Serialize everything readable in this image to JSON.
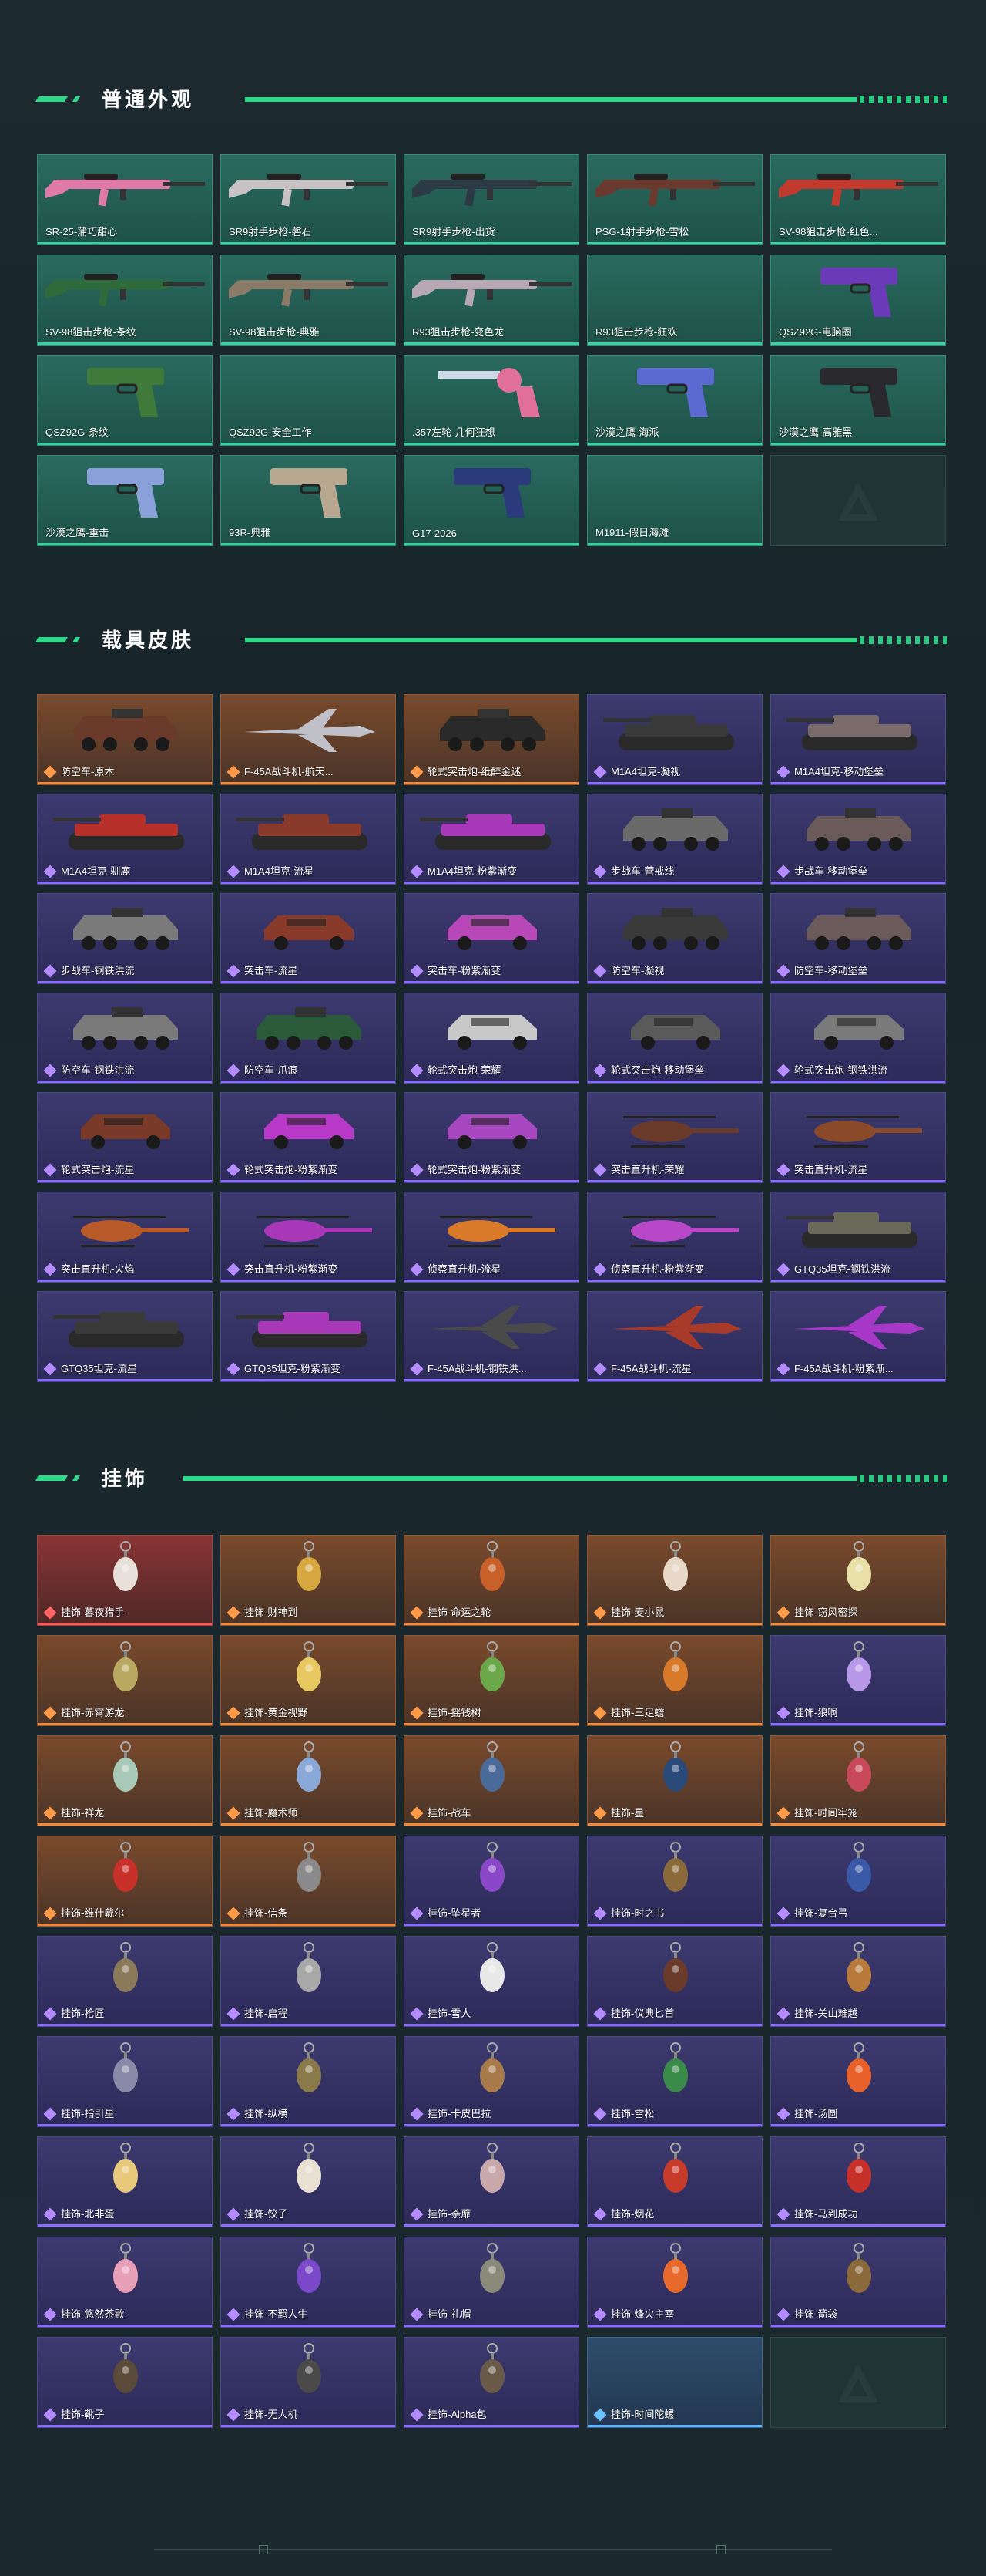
{
  "colors": {
    "accent": "#2fd98a",
    "teal": "#2a6a5f",
    "purple": "#3d3a70",
    "orange": "#7a4a2c",
    "red": "#8a3434",
    "blue": "#2e4c6c"
  },
  "sections": [
    {
      "title": "普通外观",
      "items": [
        {
          "label": "SR-25-蒲巧甜心",
          "rarity": "teal",
          "art": "rifle",
          "color": "#e07aa8"
        },
        {
          "label": "SR9射手步枪-磐石",
          "rarity": "teal",
          "art": "rifle",
          "color": "#c9c2c4"
        },
        {
          "label": "SR9射手步枪-出货",
          "rarity": "teal",
          "art": "rifle",
          "color": "#2b3a44"
        },
        {
          "label": "PSG-1射手步枪-雪松",
          "rarity": "teal",
          "art": "rifle",
          "color": "#6a3a2e"
        },
        {
          "label": "SV-98狙击步枪-红色...",
          "rarity": "teal",
          "art": "rifle",
          "color": "#c23a2e"
        },
        {
          "label": "SV-98狙击步枪-条纹",
          "rarity": "teal",
          "art": "rifle",
          "color": "#2f6a3a"
        },
        {
          "label": "SV-98狙击步枪-典雅",
          "rarity": "teal",
          "art": "rifle",
          "color": "#8a7a68"
        },
        {
          "label": "R93狙击步枪-变色龙",
          "rarity": "teal",
          "art": "rifle",
          "color": "#b8a8b4"
        },
        {
          "label": "R93狙击步枪-狂欢",
          "rarity": "teal",
          "art": "none",
          "color": "#000000"
        },
        {
          "label": "QSZ92G-电脑圈",
          "rarity": "teal",
          "art": "pistol",
          "color": "#6a3ab8"
        },
        {
          "label": "QSZ92G-条纹",
          "rarity": "teal",
          "art": "pistol",
          "color": "#3f7a3a"
        },
        {
          "label": "QSZ92G-安全工作",
          "rarity": "teal",
          "art": "none",
          "color": "#000000"
        },
        {
          "label": ".357左轮-几何狂想",
          "rarity": "teal",
          "art": "revolver",
          "color": "#e0709a"
        },
        {
          "label": "沙漠之鹰-海派",
          "rarity": "teal",
          "art": "pistol",
          "color": "#5a6ad0"
        },
        {
          "label": "沙漠之鹰-高雅黑",
          "rarity": "teal",
          "art": "pistol",
          "color": "#2a2a2e"
        },
        {
          "label": "沙漠之鹰-重击",
          "rarity": "teal",
          "art": "pistol",
          "color": "#8aa0d8"
        },
        {
          "label": "93R-典雅",
          "rarity": "teal",
          "art": "pistol",
          "color": "#b8a890"
        },
        {
          "label": "G17-2026",
          "rarity": "teal",
          "art": "pistol",
          "color": "#2a3a7a"
        },
        {
          "label": "M1911-假日海滩",
          "rarity": "teal",
          "art": "none",
          "color": "#000000"
        },
        {
          "label": "",
          "rarity": "empty",
          "art": "logo",
          "color": "#3a5856"
        }
      ]
    },
    {
      "title": "载具皮肤",
      "items": [
        {
          "label": "防空车-原木",
          "rarity": "orange",
          "art": "apc",
          "color": "#6a3a2a"
        },
        {
          "label": "F-45A战斗机-航天...",
          "rarity": "orange",
          "art": "jet",
          "color": "#c0c0c8"
        },
        {
          "label": "轮式突击炮-纸醉金迷",
          "rarity": "orange",
          "art": "apc",
          "color": "#2a2a2a"
        },
        {
          "label": "M1A4坦克-凝视",
          "rarity": "purple",
          "art": "tank",
          "color": "#3a3a3a"
        },
        {
          "label": "M1A4坦克-移动堡垒",
          "rarity": "purple",
          "art": "tank",
          "color": "#7a6a6a"
        },
        {
          "label": "M1A4坦克-驯鹿",
          "rarity": "purple",
          "art": "tank",
          "color": "#b8302a"
        },
        {
          "label": "M1A4坦克-流星",
          "rarity": "purple",
          "art": "tank",
          "color": "#8a3a2a"
        },
        {
          "label": "M1A4坦克-粉紫渐变",
          "rarity": "purple",
          "art": "tank",
          "color": "#a838b8"
        },
        {
          "label": "步战车-营戒线",
          "rarity": "purple",
          "art": "apc",
          "color": "#6a6a6a"
        },
        {
          "label": "步战车-移动堡垒",
          "rarity": "purple",
          "art": "apc",
          "color": "#6a5a5a"
        },
        {
          "label": "步战车-钢铁洪流",
          "rarity": "purple",
          "art": "apc",
          "color": "#7a7a7a"
        },
        {
          "label": "突击车-流星",
          "rarity": "purple",
          "art": "truck",
          "color": "#8a3a2a"
        },
        {
          "label": "突击车-粉紫渐变",
          "rarity": "purple",
          "art": "truck",
          "color": "#b848b8"
        },
        {
          "label": "防空车-凝视",
          "rarity": "purple",
          "art": "apc",
          "color": "#3a3a3a"
        },
        {
          "label": "防空车-移动堡垒",
          "rarity": "purple",
          "art": "apc",
          "color": "#6a5a5a"
        },
        {
          "label": "防空车-钢铁洪流",
          "rarity": "purple",
          "art": "apc",
          "color": "#7a7a7a"
        },
        {
          "label": "防空车-爪痕",
          "rarity": "purple",
          "art": "apc",
          "color": "#2a5a3a"
        },
        {
          "label": "轮式突击炮-荣耀",
          "rarity": "purple",
          "art": "truck",
          "color": "#c8c8c8"
        },
        {
          "label": "轮式突击炮-移动堡垒",
          "rarity": "purple",
          "art": "truck",
          "color": "#5a5a5a"
        },
        {
          "label": "轮式突击炮-钢铁洪流",
          "rarity": "purple",
          "art": "truck",
          "color": "#7a7a7a"
        },
        {
          "label": "轮式突击炮-流星",
          "rarity": "purple",
          "art": "truck",
          "color": "#7a3a2a"
        },
        {
          "label": "轮式突击炮-粉紫渐变",
          "rarity": "purple",
          "art": "truck",
          "color": "#b838c8"
        },
        {
          "label": "轮式突击炮-粉紫渐变",
          "rarity": "purple",
          "art": "truck",
          "color": "#a848c0"
        },
        {
          "label": "突击直升机-荣耀",
          "rarity": "purple",
          "art": "heli",
          "color": "#6a3a2a"
        },
        {
          "label": "突击直升机-流星",
          "rarity": "purple",
          "art": "heli",
          "color": "#8a4a2a"
        },
        {
          "label": "突击直升机-火焰",
          "rarity": "purple",
          "art": "heli",
          "color": "#b85a2a"
        },
        {
          "label": "突击直升机-粉紫渐变",
          "rarity": "purple",
          "art": "heli",
          "color": "#a838b8"
        },
        {
          "label": "侦察直升机-流星",
          "rarity": "purple",
          "art": "heli",
          "color": "#d87a2a"
        },
        {
          "label": "侦察直升机-粉紫渐变",
          "rarity": "purple",
          "art": "heli",
          "color": "#b848c8"
        },
        {
          "label": "GTQ35坦克-钢铁洪流",
          "rarity": "purple",
          "art": "tank",
          "color": "#6a6a5a"
        },
        {
          "label": "GTQ35坦克-流星",
          "rarity": "purple",
          "art": "tank",
          "color": "#3a3a3a"
        },
        {
          "label": "GTQ35坦克-粉紫渐变",
          "rarity": "purple",
          "art": "tank",
          "color": "#a838b8"
        },
        {
          "label": "F-45A战斗机-钢铁洪...",
          "rarity": "purple",
          "art": "jet",
          "color": "#4a4a4a"
        },
        {
          "label": "F-45A战斗机-流星",
          "rarity": "purple",
          "art": "jet",
          "color": "#a83a2a"
        },
        {
          "label": "F-45A战斗机-粉紫渐...",
          "rarity": "purple",
          "art": "jet",
          "color": "#a838c8"
        }
      ]
    },
    {
      "title": "挂饰",
      "items": [
        {
          "label": "挂饰-暮夜猎手",
          "rarity": "red",
          "art": "charm",
          "color": "#e8e0d8"
        },
        {
          "label": "挂饰-财神到",
          "rarity": "orange",
          "art": "charm",
          "color": "#d8a840"
        },
        {
          "label": "挂饰-命运之轮",
          "rarity": "orange",
          "art": "charm",
          "color": "#c8602a"
        },
        {
          "label": "挂饰-麦小鼠",
          "rarity": "orange",
          "art": "charm",
          "color": "#e8d8c8"
        },
        {
          "label": "挂饰-窃风密探",
          "rarity": "orange",
          "art": "charm",
          "color": "#e8e0a8"
        },
        {
          "label": "挂饰-赤霄游龙",
          "rarity": "orange",
          "art": "charm",
          "color": "#b8a860"
        },
        {
          "label": "挂饰-黄金视野",
          "rarity": "orange",
          "art": "charm",
          "color": "#e8c860"
        },
        {
          "label": "挂饰-摇钱树",
          "rarity": "orange",
          "art": "charm",
          "color": "#6aa84a"
        },
        {
          "label": "挂饰-三足蟾",
          "rarity": "orange",
          "art": "charm",
          "color": "#d87a2a"
        },
        {
          "label": "挂饰-狼啊",
          "rarity": "purple",
          "art": "charm",
          "color": "#b898e8"
        },
        {
          "label": "挂饰-祥龙",
          "rarity": "orange",
          "art": "charm",
          "color": "#a8c8b8"
        },
        {
          "label": "挂饰-魔术师",
          "rarity": "orange",
          "art": "charm",
          "color": "#8aa8d8"
        },
        {
          "label": "挂饰-战车",
          "rarity": "orange",
          "art": "charm",
          "color": "#4a6a9a"
        },
        {
          "label": "挂饰-星",
          "rarity": "orange",
          "art": "charm",
          "color": "#2a4a7a"
        },
        {
          "label": "挂饰-时间牢笼",
          "rarity": "orange",
          "art": "charm",
          "color": "#c84a5a"
        },
        {
          "label": "挂饰-维什戴尔",
          "rarity": "orange",
          "art": "charm",
          "color": "#c8302a"
        },
        {
          "label": "挂饰-信条",
          "rarity": "orange",
          "art": "charm",
          "color": "#8a8a8a"
        },
        {
          "label": "挂饰-坠星者",
          "rarity": "purple",
          "art": "charm",
          "color": "#8a48c8"
        },
        {
          "label": "挂饰-时之书",
          "rarity": "purple",
          "art": "charm",
          "color": "#8a6a3a"
        },
        {
          "label": "挂饰-复合弓",
          "rarity": "purple",
          "art": "charm",
          "color": "#3a5aa8"
        },
        {
          "label": "挂饰-枪匠",
          "rarity": "purple",
          "art": "charm",
          "color": "#8a7a5a"
        },
        {
          "label": "挂饰-启程",
          "rarity": "purple",
          "art": "charm",
          "color": "#a8a8a8"
        },
        {
          "label": "挂饰-雪人",
          "rarity": "purple",
          "art": "charm",
          "color": "#e8e8e8"
        },
        {
          "label": "挂饰-仪典匕首",
          "rarity": "purple",
          "art": "charm",
          "color": "#6a3a2a"
        },
        {
          "label": "挂饰-关山难越",
          "rarity": "purple",
          "art": "charm",
          "color": "#b87a3a"
        },
        {
          "label": "挂饰-指引星",
          "rarity": "purple",
          "art": "charm",
          "color": "#8a8aa8"
        },
        {
          "label": "挂饰-纵横",
          "rarity": "purple",
          "art": "charm",
          "color": "#8a7a4a"
        },
        {
          "label": "挂饰-卡皮巴拉",
          "rarity": "purple",
          "art": "charm",
          "color": "#a87a4a"
        },
        {
          "label": "挂饰-雪松",
          "rarity": "purple",
          "art": "charm",
          "color": "#3a8a4a"
        },
        {
          "label": "挂饰-汤圆",
          "rarity": "purple",
          "art": "charm",
          "color": "#e8602a"
        },
        {
          "label": "挂饰-北非蛋",
          "rarity": "purple",
          "art": "charm",
          "color": "#e8c87a"
        },
        {
          "label": "挂饰-饺子",
          "rarity": "purple",
          "art": "charm",
          "color": "#e8e0d0"
        },
        {
          "label": "挂饰-荼蘼",
          "rarity": "purple",
          "art": "charm",
          "color": "#c8a8a8"
        },
        {
          "label": "挂饰-烟花",
          "rarity": "purple",
          "art": "charm",
          "color": "#c83a2a"
        },
        {
          "label": "挂饰-马到成功",
          "rarity": "purple",
          "art": "charm",
          "color": "#c8302a"
        },
        {
          "label": "挂饰-悠然茶歇",
          "rarity": "purple",
          "art": "charm",
          "color": "#e8a0b8"
        },
        {
          "label": "挂饰-不羁人生",
          "rarity": "purple",
          "art": "charm",
          "color": "#7a48c8"
        },
        {
          "label": "挂饰-礼帽",
          "rarity": "purple",
          "art": "charm",
          "color": "#8a8a7a"
        },
        {
          "label": "挂饰-烽火主宰",
          "rarity": "purple",
          "art": "charm",
          "color": "#e86a2a"
        },
        {
          "label": "挂饰-箭袋",
          "rarity": "purple",
          "art": "charm",
          "color": "#8a6a3a"
        },
        {
          "label": "挂饰-靴子",
          "rarity": "purple",
          "art": "charm",
          "color": "#5a4a3a"
        },
        {
          "label": "挂饰-无人机",
          "rarity": "purple",
          "art": "charm",
          "color": "#4a4a4a"
        },
        {
          "label": "挂饰-Alpha包",
          "rarity": "purple",
          "art": "charm",
          "color": "#6a5a4a"
        },
        {
          "label": "挂饰-时间陀螺",
          "rarity": "blue",
          "art": "none",
          "color": "#000000"
        },
        {
          "label": "",
          "rarity": "empty",
          "art": "logo",
          "color": "#3a5856"
        }
      ]
    }
  ]
}
